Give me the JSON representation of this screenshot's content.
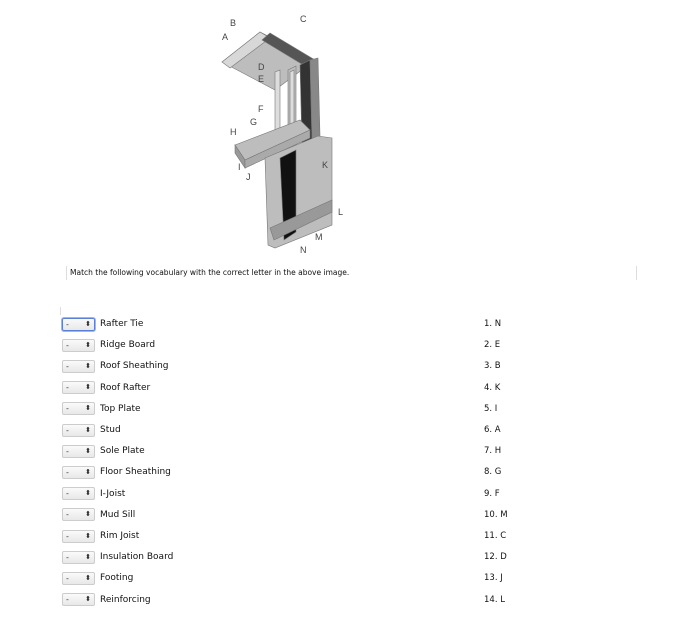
{
  "diagram": {
    "labels": [
      "A",
      "B",
      "C",
      "D",
      "E",
      "F",
      "G",
      "H",
      "I",
      "J",
      "K",
      "L",
      "M",
      "N"
    ]
  },
  "prompt": "Match the following vocabulary with the correct letter in the above image.",
  "select_placeholder": "-",
  "items": [
    "Rafter Tie",
    "Ridge Board",
    "Roof Sheathing",
    "Roof Rafter",
    "Top Plate",
    "Stud",
    "Sole Plate",
    "Floor Sheathing",
    "I-Joist",
    "Mud Sill",
    "Rim Joist",
    "Insulation Board",
    "Footing",
    "Reinforcing"
  ],
  "answers": [
    "1. N",
    "2. E",
    "3. B",
    "4. K",
    "5. I",
    "6. A",
    "7. H",
    "8. G",
    "9. F",
    "10. M",
    "11. C",
    "12. D",
    "13. J",
    "14. L"
  ]
}
